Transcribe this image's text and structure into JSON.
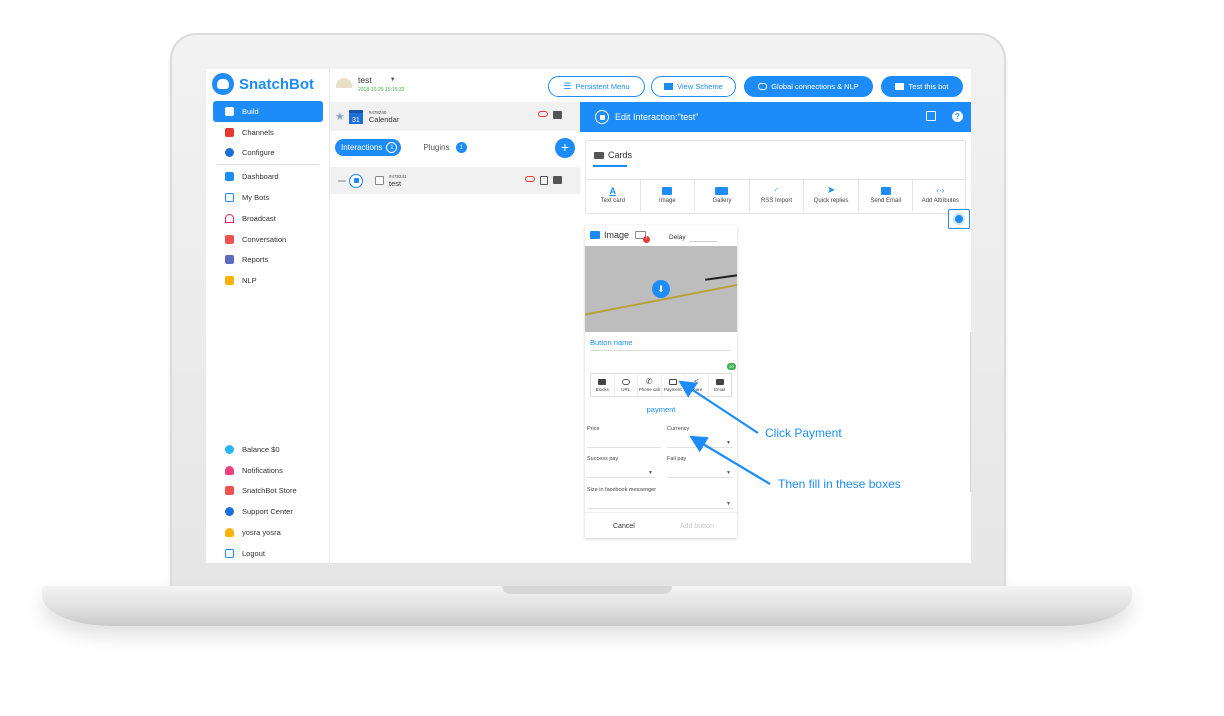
{
  "app": {
    "logo_text": "SnatchBot"
  },
  "colors": {
    "accent": "#1d8cf8",
    "link_red": "#e53935",
    "success": "#46b35a"
  },
  "sidebar": {
    "items": [
      {
        "label": "Build",
        "icon": "wrench-icon",
        "active": true,
        "color": "#ffffff"
      },
      {
        "label": "Channels",
        "icon": "channels-icon",
        "color": "#e53935"
      },
      {
        "label": "Configure",
        "icon": "gear-icon",
        "color": "#1d6fd8"
      },
      {
        "label": "Dashboard",
        "icon": "dashboard-icon",
        "color": "#1d8cf8"
      },
      {
        "label": "My Bots",
        "icon": "bots-icon",
        "color": "#1d8cf8"
      },
      {
        "label": "Broadcast",
        "icon": "broadcast-icon",
        "color": "#e91e63"
      },
      {
        "label": "Conversation",
        "icon": "conversation-icon",
        "color": "#ef5350"
      },
      {
        "label": "Reports",
        "icon": "reports-icon",
        "color": "#5c6bc0"
      },
      {
        "label": "NLP",
        "icon": "nlp-icon",
        "color": "#ffb300"
      }
    ],
    "bottom_items": [
      {
        "label": "Balance $0",
        "icon": "balance-icon",
        "color": "#29b6f6"
      },
      {
        "label": "Notifications",
        "icon": "bell-icon",
        "color": "#ec407a"
      },
      {
        "label": "SnatchBot Store",
        "icon": "store-icon",
        "color": "#ef5350"
      },
      {
        "label": "Support Center",
        "icon": "help-icon",
        "color": "#1d6fd8"
      },
      {
        "label": "yosra yosra",
        "icon": "user-icon",
        "color": "#ffb300"
      },
      {
        "label": "Logout",
        "icon": "logout-icon",
        "color": "#1d8cf8"
      }
    ]
  },
  "topbar": {
    "bot_name": "test",
    "bot_date": "2018-10-29 15:15:32",
    "persistent_menu": "Persistent Menu",
    "view_scheme": "View Scheme",
    "global_connections": "Global connections & NLP",
    "test_bot": "Test this bot"
  },
  "interactions_panel": {
    "pinned": {
      "id": "#478240",
      "title": "Calendar",
      "calendar_day": "31"
    },
    "tabs": [
      {
        "label": "Interactions",
        "count": "1",
        "active": true
      },
      {
        "label": "Plugins",
        "count": "1",
        "active": false
      }
    ],
    "list": [
      {
        "id": "#478241",
        "title": "test"
      }
    ]
  },
  "editor": {
    "title": "Edit Interaction:\"test\"",
    "cards_title": "Cards",
    "card_types": [
      {
        "label": "Text card",
        "icon": "text-card-icon"
      },
      {
        "label": "Image",
        "icon": "image-icon"
      },
      {
        "label": "Gallery",
        "icon": "gallery-icon"
      },
      {
        "label": "RSS Import",
        "icon": "rss-icon"
      },
      {
        "label": "Quick replies",
        "icon": "send-icon"
      },
      {
        "label": "Send Email",
        "icon": "email-icon"
      },
      {
        "label": "Add Attributes",
        "icon": "code-icon"
      }
    ],
    "image_card": {
      "title": "Image",
      "badge": "!",
      "delay_label": "Delay",
      "button_name": "Button name",
      "counter": "20",
      "button_types": [
        {
          "label": "Blocks",
          "icon": "blocks-icon"
        },
        {
          "label": "URL",
          "icon": "link-icon"
        },
        {
          "label": "Phone call",
          "icon": "phone-icon"
        },
        {
          "label": "Payment",
          "icon": "credit-card-icon",
          "selected": true
        },
        {
          "label": "Share",
          "icon": "share-icon"
        },
        {
          "label": "Email",
          "icon": "email-icon"
        }
      ],
      "selected_type": "payment",
      "fields": {
        "price": "Price",
        "currency": "Currency",
        "success_pay": "Success pay",
        "fail_pay": "Fail pay",
        "size": "Size in facebook messenger"
      },
      "cancel": "Cancel",
      "add_button": "Add button"
    }
  },
  "annotations": {
    "click_payment": "Click Payment",
    "fill_boxes": "Then fill in these boxes"
  }
}
